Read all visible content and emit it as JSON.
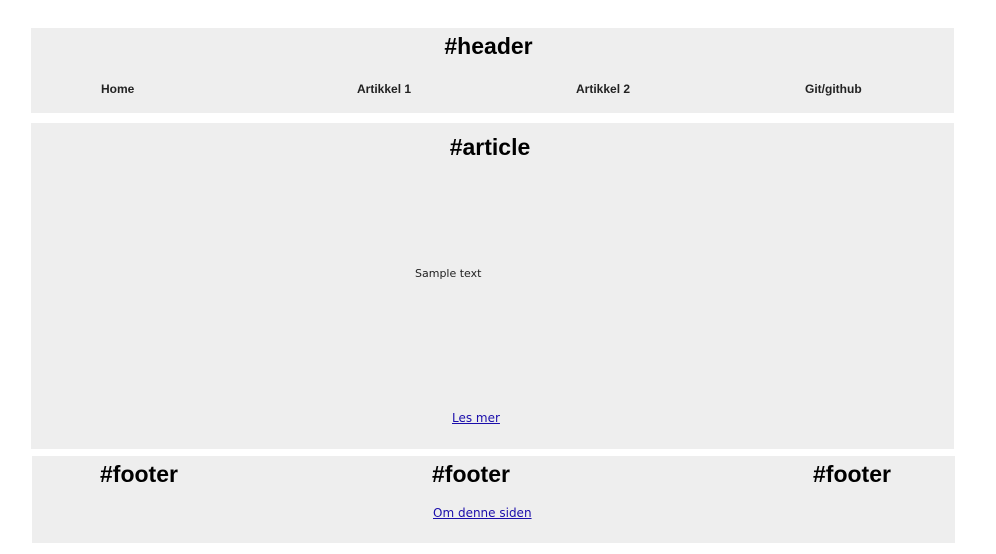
{
  "header": {
    "title": "#header",
    "nav": [
      {
        "label": "Home"
      },
      {
        "label": "Artikkel 1"
      },
      {
        "label": "Artikkel 2"
      },
      {
        "label": "Git/github"
      }
    ]
  },
  "article": {
    "title": "#article",
    "body_text": "Sample text",
    "read_more_link": "Les mer"
  },
  "footer": {
    "titles": [
      "#footer",
      "#footer",
      "#footer"
    ],
    "about_link": "Om denne siden"
  },
  "colors": {
    "panel_background": "#eeeeee",
    "link": "#1a0dab",
    "text": "#000000"
  }
}
